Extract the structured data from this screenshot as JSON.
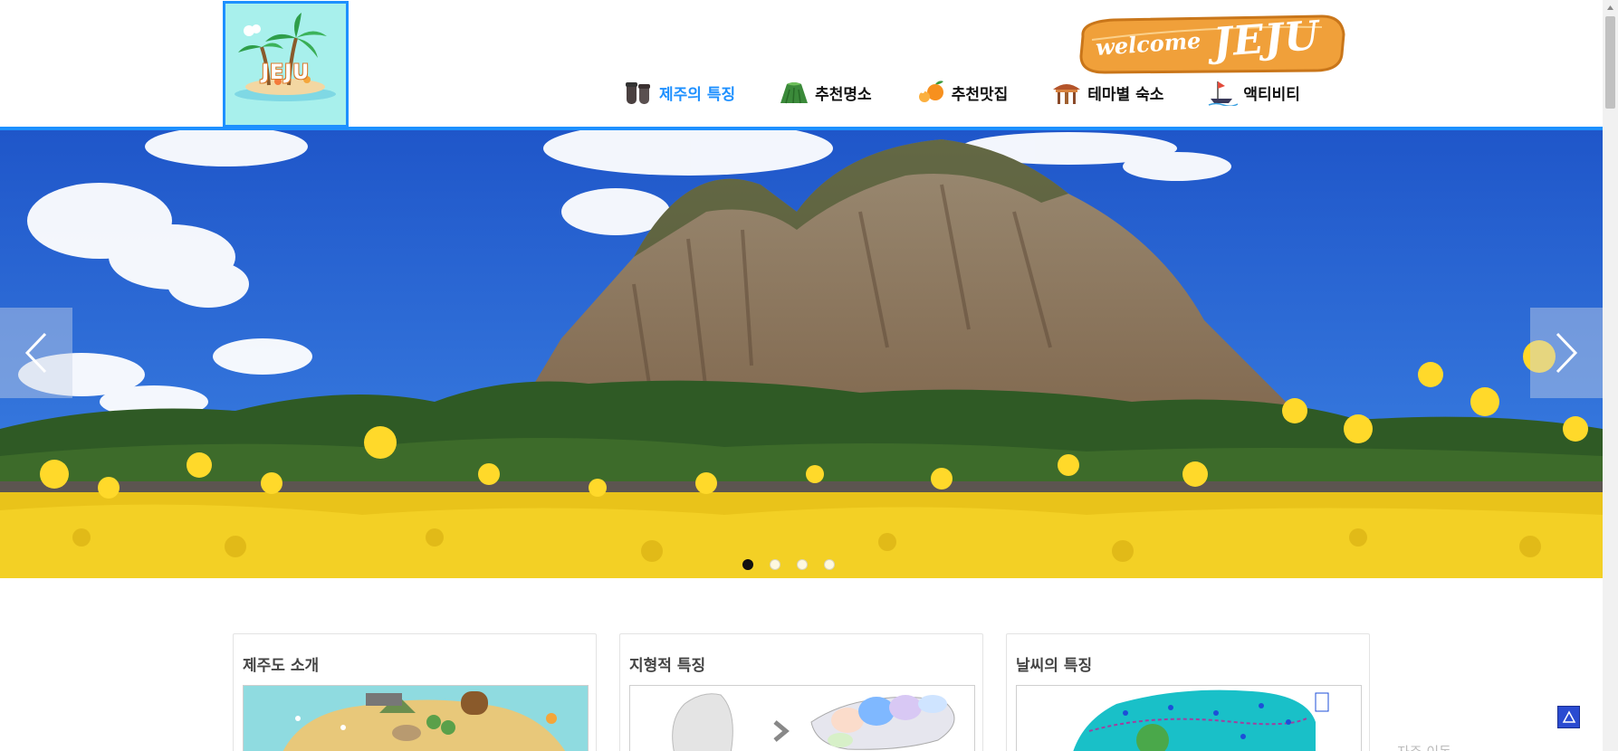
{
  "header": {
    "logo_text": "JEJU",
    "welcome_small": "welcome",
    "welcome_big": "JEJU",
    "nav": [
      {
        "label": "제주의 특징",
        "icon": "dolhareubang-icon",
        "active": true
      },
      {
        "label": "추천명소",
        "icon": "mountain-icon",
        "active": false
      },
      {
        "label": "추천맛집",
        "icon": "tangerine-icon",
        "active": false
      },
      {
        "label": "테마별 숙소",
        "icon": "pavilion-icon",
        "active": false
      },
      {
        "label": "액티비티",
        "icon": "sailboat-icon",
        "active": false
      }
    ]
  },
  "hero": {
    "slide_count": 4,
    "active_slide": 1,
    "prev_icon": "chevron-left-icon",
    "next_icon": "chevron-right-icon"
  },
  "cards": [
    {
      "title": "제주도 소개"
    },
    {
      "title": "지형적 특징"
    },
    {
      "title": "날씨의 특징"
    }
  ],
  "misc": {
    "top_icon": "arrow-up-triangle-icon",
    "faded_text": "자주 이동"
  },
  "colors": {
    "accent": "#1e90ff",
    "welcome_badge": "#f0a03a",
    "top_button": "#2a4bd1"
  }
}
